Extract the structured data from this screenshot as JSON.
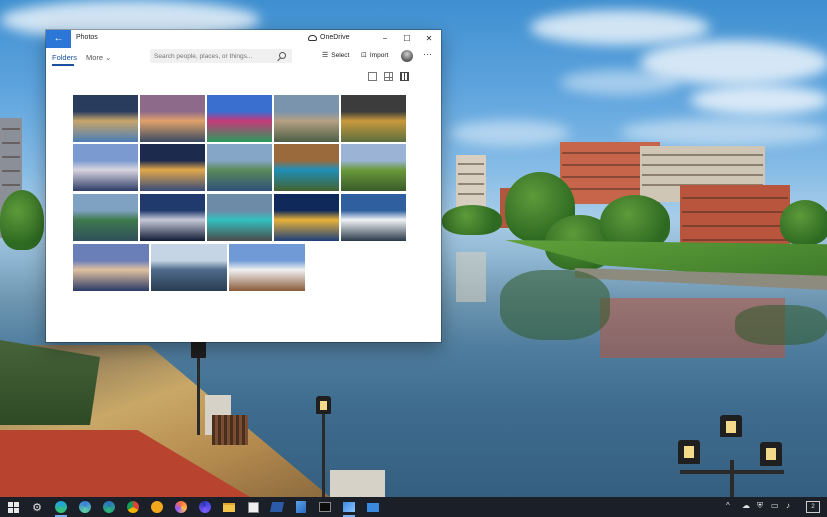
{
  "window": {
    "app_title": "Photos",
    "back_symbol": "←",
    "onedrive_label": "OneDrive",
    "minimize_symbol": "−",
    "maximize_symbol": "☐",
    "close_symbol": "✕"
  },
  "command_bar": {
    "tab_folders": "Folders",
    "tab_more": "More ⌄",
    "search_placeholder": "Search people, places, or things...",
    "select_label": "Select",
    "import_label": "Import",
    "more_options": "···"
  },
  "icons": {
    "back": "back-arrow-icon",
    "onedrive": "cloud-icon",
    "search": "search-icon",
    "select": "select-list-icon",
    "import": "import-icon",
    "profile": "avatar-icon",
    "more": "more-dots-icon",
    "view_large": "view-large-icon",
    "view_medium": "view-medium-icon",
    "view_small": "view-small-icon"
  },
  "photos": [
    {
      "name": "fountain-palace",
      "colors": [
        "#2a3c5e",
        "#c7a66a",
        "#4c7db6"
      ]
    },
    {
      "name": "sunset-city",
      "colors": [
        "#8e6a8a",
        "#e0a26a",
        "#3a4a63"
      ]
    },
    {
      "name": "circus-dome",
      "colors": [
        "#3a6fd0",
        "#c43a7a",
        "#2b9a5c"
      ]
    },
    {
      "name": "hilltop-town",
      "colors": [
        "#7a94ad",
        "#b5a082",
        "#4d5f46"
      ]
    },
    {
      "name": "stormy-mountains",
      "colors": [
        "#3c3c3c",
        "#c89a3c",
        "#5d6f3e"
      ]
    },
    {
      "name": "river-bridge-dusk",
      "colors": [
        "#7a9ad0",
        "#d9d4e0",
        "#2c3c66"
      ]
    },
    {
      "name": "lit-arch-night",
      "colors": [
        "#1b2a4d",
        "#e2a84a",
        "#364a78"
      ]
    },
    {
      "name": "lake-city",
      "colors": [
        "#86a6c8",
        "#5a8a5a",
        "#30507a"
      ]
    },
    {
      "name": "blue-lake-canyon",
      "colors": [
        "#9a6a3c",
        "#1f8fb6",
        "#45622f"
      ]
    },
    {
      "name": "green-valley",
      "colors": [
        "#9bb4d6",
        "#6a9a3a",
        "#3a5a2a"
      ]
    },
    {
      "name": "mountain-river",
      "colors": [
        "#7fa2c2",
        "#3e7a4e",
        "#2f4f5a"
      ]
    },
    {
      "name": "tv-tower-night",
      "colors": [
        "#213a6e",
        "#c7c9d9",
        "#101a33"
      ]
    },
    {
      "name": "crater-lake",
      "colors": [
        "#6d8aa6",
        "#35c0c0",
        "#4a4a4a"
      ]
    },
    {
      "name": "golden-pagoda",
      "colors": [
        "#0f2a5a",
        "#e8b23a",
        "#1d3f7a"
      ]
    },
    {
      "name": "snowy-peaks",
      "colors": [
        "#2f5f9e",
        "#f0f2f5",
        "#2a3a4a"
      ]
    },
    {
      "name": "kremlin-river",
      "colors": [
        "#6a7fb8",
        "#e0c0a0",
        "#2a3a66"
      ]
    },
    {
      "name": "skyline-water",
      "colors": [
        "#c6d5e6",
        "#4e6a88",
        "#2a3c52"
      ]
    },
    {
      "name": "alpine-village",
      "colors": [
        "#6f9ad6",
        "#f0f0f0",
        "#8a5a3a"
      ]
    }
  ],
  "taskbar": {
    "apps": [
      "start-icon",
      "settings-icon",
      "edge-icon",
      "edge-beta-icon",
      "edge-dev-icon",
      "chrome-icon",
      "chrome-canary-icon",
      "firefox-icon",
      "firefox-nightly-icon",
      "file-explorer-icon",
      "store-icon",
      "powershell-icon",
      "maps-icon",
      "terminal-icon",
      "photos-icon",
      "mail-icon"
    ],
    "tray_chevron": "^",
    "notification_count": "2"
  }
}
